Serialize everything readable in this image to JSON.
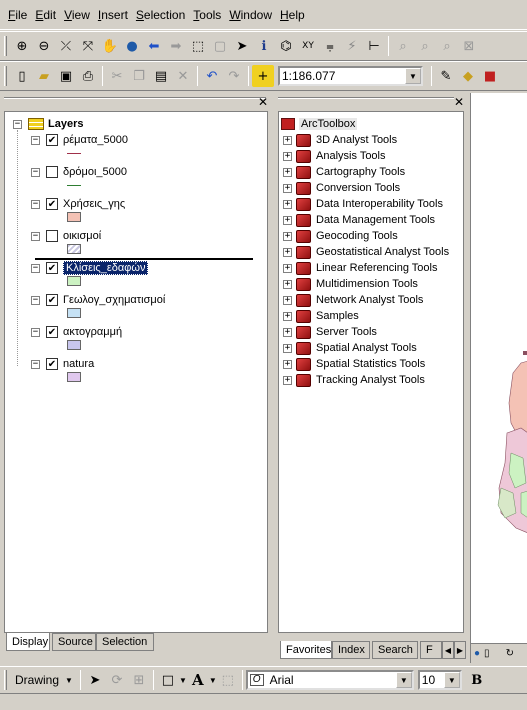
{
  "menu": [
    "File",
    "Edit",
    "View",
    "Insert",
    "Selection",
    "Tools",
    "Window",
    "Help"
  ],
  "toolbar": {
    "scale": "1:186.077"
  },
  "toc": {
    "root": "Layers",
    "layers": [
      {
        "name": "ρέματα_5000",
        "checked": true,
        "symbol": "line",
        "color": "#a0304a"
      },
      {
        "name": "δρόμοι_5000",
        "checked": false,
        "symbol": "line",
        "color": "#2e7d32"
      },
      {
        "name": "Χρήσεις_γης",
        "checked": true,
        "symbol": "fill",
        "color": "#f4c2b5"
      },
      {
        "name": "οικισμοί",
        "checked": false,
        "symbol": "hatch",
        "color": "#c9c7e0"
      },
      {
        "name": "Κλίσεις_εδαφών",
        "checked": true,
        "symbol": "fill",
        "color": "#ccf2c2",
        "selected": true
      },
      {
        "name": "Γεωλογ_σχηματισμοί",
        "checked": true,
        "symbol": "fill",
        "color": "#c6e2f5"
      },
      {
        "name": "ακτογραμμή",
        "checked": true,
        "symbol": "fill",
        "color": "#c8c6ee"
      },
      {
        "name": "natura",
        "checked": true,
        "symbol": "fill",
        "color": "#e0c8ee"
      }
    ],
    "tabs": [
      "Display",
      "Source",
      "Selection"
    ]
  },
  "toolbox": {
    "root": "ArcToolbox",
    "items": [
      "3D Analyst Tools",
      "Analysis Tools",
      "Cartography Tools",
      "Conversion Tools",
      "Data Interoperability Tools",
      "Data Management Tools",
      "Geocoding Tools",
      "Geostatistical Analyst Tools",
      "Linear Referencing Tools",
      "Multidimension Tools",
      "Network Analyst Tools",
      "Samples",
      "Server Tools",
      "Spatial Analyst Tools",
      "Spatial Statistics Tools",
      "Tracking Analyst Tools"
    ],
    "tabs": [
      "Favorites",
      "Index",
      "Search",
      "F"
    ]
  },
  "drawing": {
    "label": "Drawing",
    "font": "Arial",
    "size": "10",
    "bold": "B",
    "text_tool": "A"
  }
}
